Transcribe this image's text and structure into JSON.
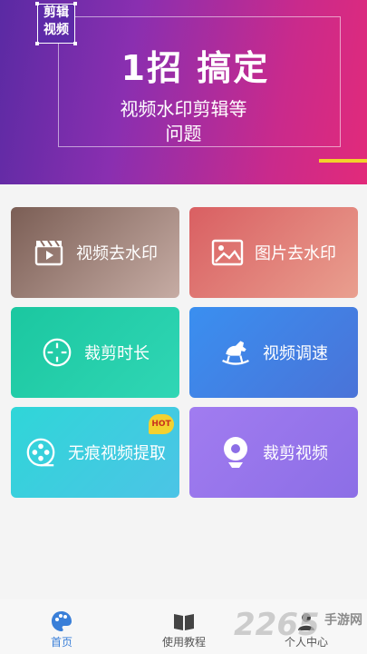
{
  "banner": {
    "logo_line1": "剪辑",
    "logo_line2": "视频",
    "headline": "1招 搞定",
    "subtitle_line1": "视频水印剪辑等",
    "subtitle_line2": "问题"
  },
  "features": [
    {
      "label": "视频去水印",
      "icon": "clapperboard-icon"
    },
    {
      "label": "图片去水印",
      "icon": "image-icon"
    },
    {
      "label": "裁剪时长",
      "icon": "crosshair-icon"
    },
    {
      "label": "视频调速",
      "icon": "rocking-horse-icon"
    },
    {
      "label": "无痕视频提取",
      "icon": "film-reel-icon",
      "badge": "HOT"
    },
    {
      "label": "裁剪视频",
      "icon": "webcam-icon"
    }
  ],
  "tabs": [
    {
      "label": "首页",
      "icon": "palette-icon",
      "active": true
    },
    {
      "label": "使用教程",
      "icon": "book-icon",
      "active": false
    },
    {
      "label": "个人中心",
      "icon": "person-icon",
      "active": false
    }
  ],
  "watermark": {
    "number": "2265",
    "site": "手游网"
  },
  "colors": {
    "accent": "#3a7fd8",
    "badge": "#f3d12f",
    "banner_start": "#5a2aa3",
    "banner_end": "#e22a7a"
  }
}
